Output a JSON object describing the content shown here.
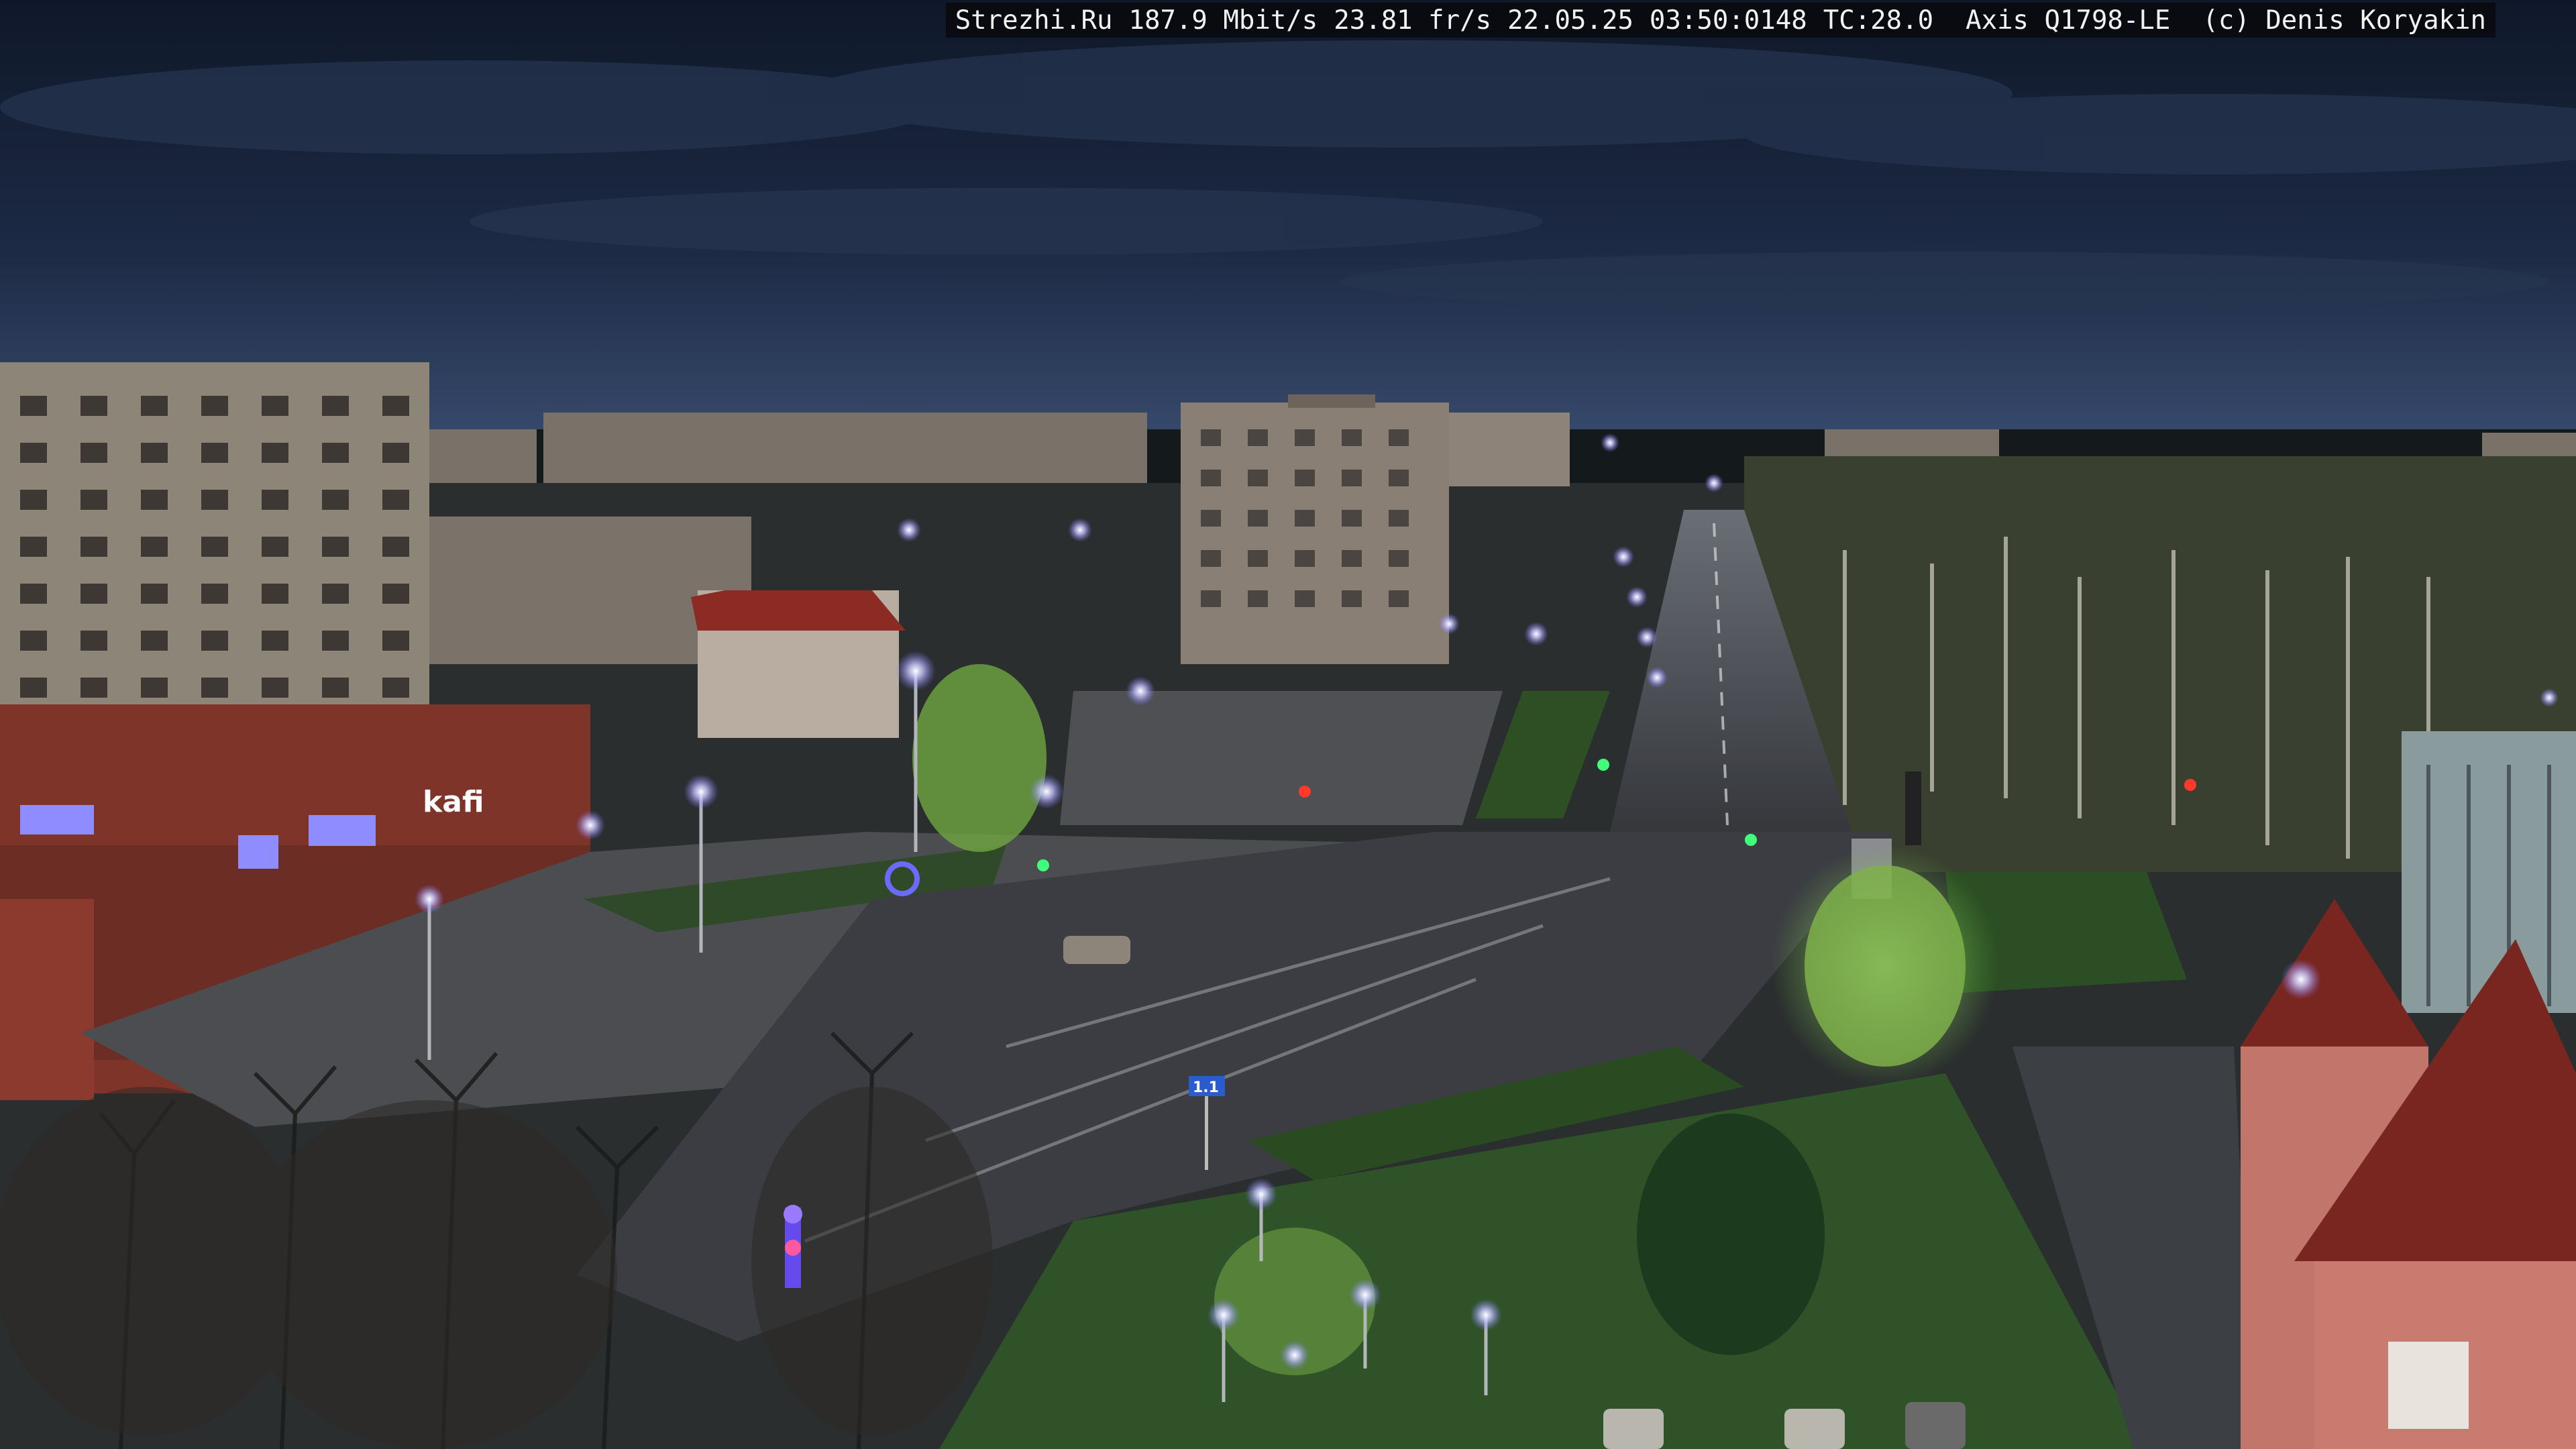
{
  "overlay": {
    "site": "Strezhi.Ru",
    "bitrate": "187.9 Mbit/s",
    "framerate": "23.81 fr/s",
    "date": "22.05.25",
    "time": "03:50:0148",
    "tc": "TC:28.0",
    "camera": "Axis Q1798-LE",
    "copyright": "(c) Denis Koryakin"
  },
  "signs": {
    "store_sign": "kafi",
    "road_sign": "1.1"
  },
  "colors": {
    "sky_top": "#121c33",
    "sky_horizon": "#33466a",
    "street_light": "#d8d8ff",
    "grass": "#2d4a22",
    "asphalt": "#3e4045",
    "building_red": "#8c3a2e"
  }
}
